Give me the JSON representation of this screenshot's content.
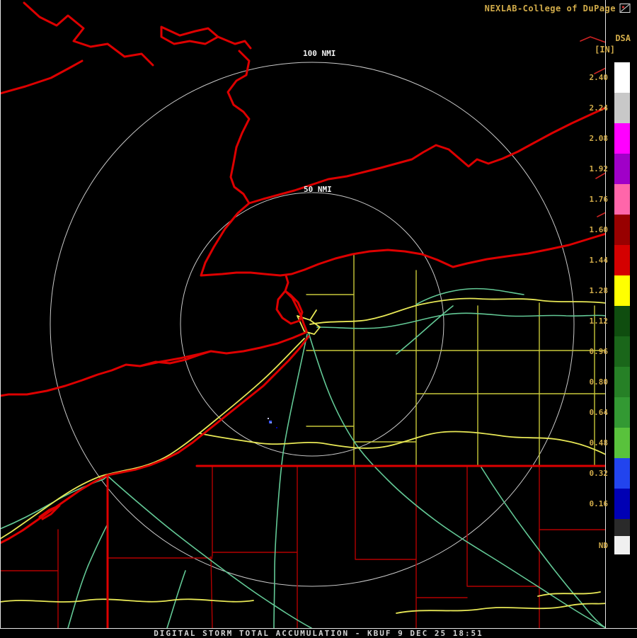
{
  "header": {
    "brand": "NEXLAB-College of DuPage",
    "logo_icon": "cod-logo",
    "product_code": "DSA",
    "units": "[IN]"
  },
  "range_rings": {
    "outer_label": "100 NMI",
    "inner_label": "50 NMI"
  },
  "colorbar": {
    "entries": [
      {
        "label": "2.40",
        "color": "#ffffff"
      },
      {
        "label": "2.24",
        "color": "#c8c8c8"
      },
      {
        "label": "2.08",
        "color": "#ff00ff"
      },
      {
        "label": "1.92",
        "color": "#a000c8"
      },
      {
        "label": "1.76",
        "color": "#ff66aa"
      },
      {
        "label": "1.60",
        "color": "#980000"
      },
      {
        "label": "1.44",
        "color": "#d40000"
      },
      {
        "label": "1.28",
        "color": "#ffff00"
      },
      {
        "label": "1.12",
        "color": "#0f4d0f"
      },
      {
        "label": "0.96",
        "color": "#1a661a"
      },
      {
        "label": "0.80",
        "color": "#268026"
      },
      {
        "label": "0.64",
        "color": "#339933"
      },
      {
        "label": "0.48",
        "color": "#59c23c"
      },
      {
        "label": "0.32",
        "color": "#2244ee"
      },
      {
        "label": "0.16",
        "color": "#0000b4"
      },
      {
        "label": "",
        "color": "#2a2a2a"
      },
      {
        "label": "ND",
        "color": "#f0f0f0"
      }
    ]
  },
  "map": {
    "colors": {
      "state_border": "#dd0000",
      "county_pa": "#b40000",
      "county_ny": "#c8c83a",
      "road_primary": "#e8e856",
      "road_secondary": "#63c996",
      "range_ring": "#ededed",
      "misc_red": "#cc2222"
    },
    "precip_echo_colors": [
      "#3a56ff",
      "#8fa8ff",
      "#0000aa",
      "#c8c8e8"
    ]
  },
  "caption": "DIGITAL STORM TOTAL ACCUMULATION - KBUF 9 DEC 25 18:51"
}
